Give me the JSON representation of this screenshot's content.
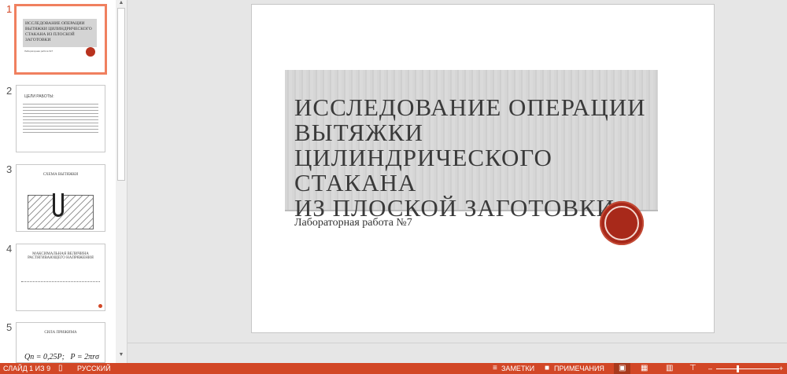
{
  "thumbnails": [
    {
      "num": "1",
      "title": "ИССЛЕДОВАНИЕ ОПЕРАЦИИ ВЫТЯЖКИ ЦИЛИНДРИЧЕСКОГО СТАКАНА ИЗ ПЛОСКОЙ ЗАГОТОВКИ",
      "sub": "Лабораторная работа №7"
    },
    {
      "num": "2",
      "title": "ЦЕЛИ РАБОТЫ:"
    },
    {
      "num": "3",
      "title": "СХЕМА ВЫТЯЖКИ"
    },
    {
      "num": "4",
      "title": "МАКСИМАЛЬНАЯ ВЕЛИЧИНА РАСТЯГИВАЮЩЕГО НАПРЯЖЕНИЯ"
    },
    {
      "num": "5",
      "title": "СИЛА ПРИЖИМА",
      "formula": "Qn = 0,25P;   P = 2πrσ"
    }
  ],
  "slide": {
    "title": "ИССЛЕДОВАНИЕ ОПЕРАЦИИ\nВЫТЯЖКИ\nЦИЛИНДРИЧЕСКОГО СТАКАНА\nИЗ ПЛОСКОЙ ЗАГОТОВКИ",
    "subtitle": "Лабораторная работа №7"
  },
  "status": {
    "slide": "СЛАЙД 1 ИЗ 9",
    "language": "РУССКИЙ",
    "notes": "ЗАМЕТКИ",
    "comments": "ПРИМЕЧАНИЯ"
  },
  "colors": {
    "accent": "#d24726",
    "seal": "#a8291a"
  }
}
